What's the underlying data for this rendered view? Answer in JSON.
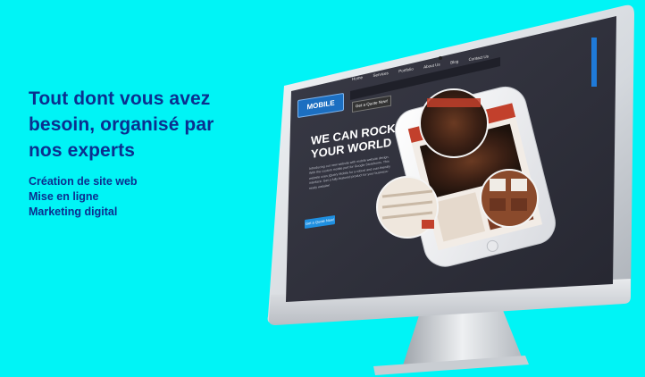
{
  "hero": {
    "title_line1": "Tout dont vous avez",
    "title_line2": "besoin, organisé par",
    "title_line3": "nos experts",
    "services": [
      "Création de site web",
      "Mise en ligne",
      "Marketing digital"
    ]
  },
  "site": {
    "logo": "MOBILE",
    "nav": [
      "Home",
      "Services",
      "Portfolio",
      "About Us",
      "Blog",
      "Contact Us"
    ],
    "nav_cta": "Get a Quote Now!",
    "headline_line1": "WE CAN ROCK",
    "headline_line2": "YOUR WORLD",
    "body_text": "Introducing our new website with mobile website design. With the custom mobile port for Google Storefronts. This website uses jQuery Mobile for a robust and user-friendly interface. Get a fully-featured product for your business-ready website!",
    "button": "Get a Quote Now!"
  },
  "colors": {
    "background": "#00f4f6",
    "heading": "#0b2f8f",
    "screen": "#2e2f3a",
    "accent": "#1f8fe0"
  }
}
